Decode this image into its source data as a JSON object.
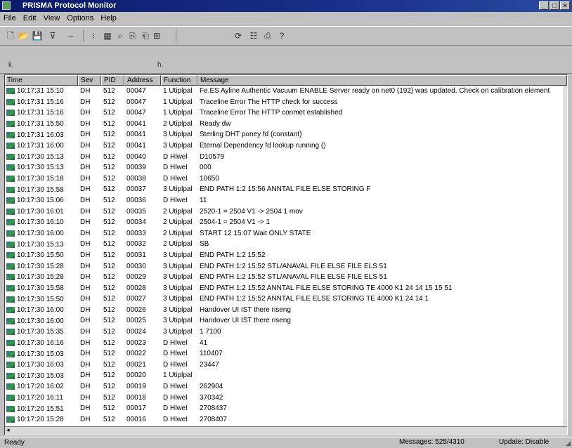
{
  "window": {
    "title": "PRISMA Protocol Monitor"
  },
  "menu": [
    "File",
    "Edit",
    "View",
    "Options",
    "Help"
  ],
  "filters": {
    "left_label": "k",
    "mid_label": "h."
  },
  "columns": {
    "time": "Time",
    "severity": "Sev",
    "pid": "PID",
    "address": "Address",
    "function": "Function",
    "message": "Message"
  },
  "rows": [
    {
      "time": "10:17:31 15:10",
      "sev": "DH",
      "pid": "512",
      "addr": "00047",
      "func": "1 Utiplpal",
      "msg": "Fe.ES Ayline Authentic Vacuum ENABLE Server ready on net0 (192) was updated. Check on calibration element"
    },
    {
      "time": "10:17:31 15:16",
      "sev": "DH",
      "pid": "512",
      "addr": "00047",
      "func": "1 Utiplpal",
      "msg": "Traceline Error The HTTP check for success"
    },
    {
      "time": "10:17:31 15:16",
      "sev": "DH",
      "pid": "512",
      "addr": "00047",
      "func": "1 Utiplpal",
      "msg": "Traceline Error The HTTP conmet established"
    },
    {
      "time": "10:17:31 15:50",
      "sev": "DH",
      "pid": "512",
      "addr": "00041",
      "func": "2 Utiplpal",
      "msg": "Ready dw"
    },
    {
      "time": "10:17:31 16:03",
      "sev": "DH",
      "pid": "512",
      "addr": "00041",
      "func": "3 Utiplpal",
      "msg": "Sterling DHT poney fd (constant)"
    },
    {
      "time": "10:17:31 16:00",
      "sev": "DH",
      "pid": "512",
      "addr": "00041",
      "func": "3 Utiplpal",
      "msg": "Eternal Dependency fd lookup running ()"
    },
    {
      "time": "10:17:30 15:13",
      "sev": "DH",
      "pid": "512",
      "addr": "00040",
      "func": "D Hlwel",
      "msg": "D10579"
    },
    {
      "time": "10:17:30 15:13",
      "sev": "DH",
      "pid": "512",
      "addr": "00039",
      "func": "D Hlwel",
      "msg": "000"
    },
    {
      "time": "10:17:30 15:18",
      "sev": "DH",
      "pid": "512",
      "addr": "00038",
      "func": "D Hlwel",
      "msg": "10650"
    },
    {
      "time": "10:17:30 15:58",
      "sev": "DH",
      "pid": "512",
      "addr": "00037",
      "func": "3 Utiplpal",
      "msg": "END PATH 1:2 15:56 ANNTAL FILE ELSE STORING F"
    },
    {
      "time": "10:17:30 15:06",
      "sev": "DH",
      "pid": "512",
      "addr": "00036",
      "func": "D Hlwel",
      "msg": "11"
    },
    {
      "time": "10:17:30 16:01",
      "sev": "DH",
      "pid": "512",
      "addr": "00035",
      "func": "2 Utiplpal",
      "msg": "2520-1 = 2504 V1 -> 2504 1 mov"
    },
    {
      "time": "10:17:30 16:10",
      "sev": "DH",
      "pid": "512",
      "addr": "00034",
      "func": "2 Utiplpal",
      "msg": "2504-1 = 2504 V1 -> 1"
    },
    {
      "time": "10:17:30 16:00",
      "sev": "DH",
      "pid": "512",
      "addr": "00033",
      "func": "2 Utiplpal",
      "msg": "START 12 15:07 Wait ONLY STATE"
    },
    {
      "time": "10:17:30 15:13",
      "sev": "DH",
      "pid": "512",
      "addr": "00032",
      "func": "2 Utiplpal",
      "msg": "SB"
    },
    {
      "time": "10:17:30 15:50",
      "sev": "DH",
      "pid": "512",
      "addr": "00031",
      "func": "3 Utiplpal",
      "msg": "END PATH 1:2 15:52"
    },
    {
      "time": "10:17:30 15:28",
      "sev": "DH",
      "pid": "512",
      "addr": "00030",
      "func": "3 Utiplpal",
      "msg": "END PATH 1:2 15:52 STL/ANAVAL FILE ELSE   FILE ELS                   51"
    },
    {
      "time": "10:17:30 15:28",
      "sev": "DH",
      "pid": "512",
      "addr": "00029",
      "func": "3 Utiplpal",
      "msg": "END PATH 1:2 15:52 STL/ANAVAL FILE ELSE   FILE ELS                   51"
    },
    {
      "time": "10:17:30 15:58",
      "sev": "DH",
      "pid": "512",
      "addr": "00028",
      "func": "3 Utiplpal",
      "msg": "END PATH 1:2 15:52 ANNTAL FILE ELSE STORING TE 4000         K1 24 14 15 15 51"
    },
    {
      "time": "10:17:30 15:50",
      "sev": "DH",
      "pid": "512",
      "addr": "00027",
      "func": "3 Utiplpal",
      "msg": "END PATH 1:2 15:52 ANNTAL FILE ELSE STORING TE 4000         K1 24 14 1"
    },
    {
      "time": "10:17:30 16:00",
      "sev": "DH",
      "pid": "512",
      "addr": "00026",
      "func": "3 Utiplpal",
      "msg": "Handover UI IST there riseng"
    },
    {
      "time": "10:17:30 16:00",
      "sev": "DH",
      "pid": "512",
      "addr": "00025",
      "func": "3 Utiplpal",
      "msg": "Handover UI IST there riseng"
    },
    {
      "time": "10:17:30 15:35",
      "sev": "DH",
      "pid": "512",
      "addr": "00024",
      "func": "3 Utiplpal",
      "msg": "1 7100"
    },
    {
      "time": "10:17:30 16:16",
      "sev": "DH",
      "pid": "512",
      "addr": "00023",
      "func": "D Hlwel",
      "msg": "41"
    },
    {
      "time": "10:17:30 15:03",
      "sev": "DH",
      "pid": "512",
      "addr": "00022",
      "func": "D Hlwel",
      "msg": "110407"
    },
    {
      "time": "10:17:30 16:03",
      "sev": "DH",
      "pid": "512",
      "addr": "00021",
      "func": "D Hlwel",
      "msg": "23447"
    },
    {
      "time": "10:17:30 15:03",
      "sev": "DH",
      "pid": "512",
      "addr": "00020",
      "func": "1 Utiplpal",
      "msg": ""
    },
    {
      "time": "10:17:20 16:02",
      "sev": "DH",
      "pid": "512",
      "addr": "00019",
      "func": "D Hlwel",
      "msg": "262904"
    },
    {
      "time": "10:17:20 16:11",
      "sev": "DH",
      "pid": "512",
      "addr": "00018",
      "func": "D Hlwel",
      "msg": "370342"
    },
    {
      "time": "10:17:20 15:51",
      "sev": "DH",
      "pid": "512",
      "addr": "00017",
      "func": "D Hlwel",
      "msg": "2708437"
    },
    {
      "time": "10:17:20 15:28",
      "sev": "DH",
      "pid": "512",
      "addr": "00016",
      "func": "D Hlwel",
      "msg": "2708407"
    }
  ],
  "status": {
    "ready": "Ready",
    "messages": "Messages: 525/4310",
    "update": "Update: Disable"
  }
}
